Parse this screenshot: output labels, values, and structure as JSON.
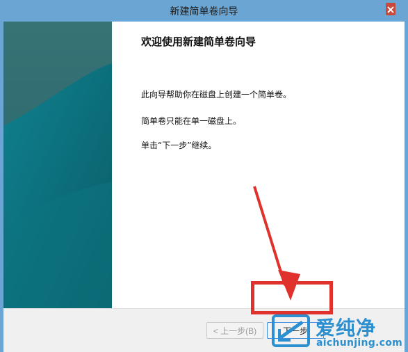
{
  "window": {
    "title": "新建简单卷向导"
  },
  "content": {
    "heading": "欢迎使用新建简单卷向导",
    "lines": [
      "此向导帮助你在磁盘上创建一个简单卷。",
      "简单卷只能在单一磁盘上。",
      "单击“下一步”继续。"
    ]
  },
  "buttons": {
    "back_label": "< 上一步(B)",
    "next_label": "下一步"
  },
  "watermark": {
    "text": "爱纯净",
    "url": "aichunjing.com"
  },
  "colors": {
    "titlebar": "#6aa5d3",
    "accent": "#e0322c",
    "watermark": "#2c8fcf"
  },
  "icons": {
    "close": "close-icon",
    "arrow": "red-arrow-annotation",
    "logo": "watermark-logo-icon"
  }
}
